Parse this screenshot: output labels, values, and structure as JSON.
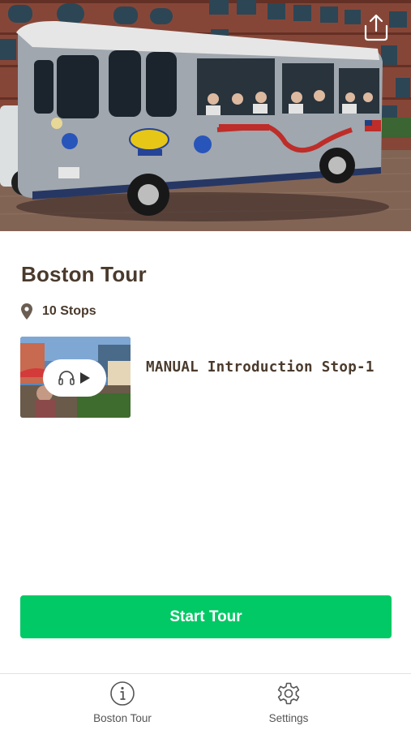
{
  "tour": {
    "title": "Boston Tour",
    "stops_label": "10 Stops"
  },
  "stops": [
    {
      "title": "MANUAL Introduction Stop-1"
    }
  ],
  "actions": {
    "start_tour_label": "Start Tour"
  },
  "tabbar": {
    "items": [
      {
        "label": "Boston Tour",
        "icon": "info-icon"
      },
      {
        "label": "Settings",
        "icon": "gear-icon"
      }
    ]
  },
  "hero": {
    "icons": [
      "share-icon"
    ]
  },
  "colors": {
    "accent_green": "#00c965",
    "text_brown": "#4a3a2c"
  }
}
